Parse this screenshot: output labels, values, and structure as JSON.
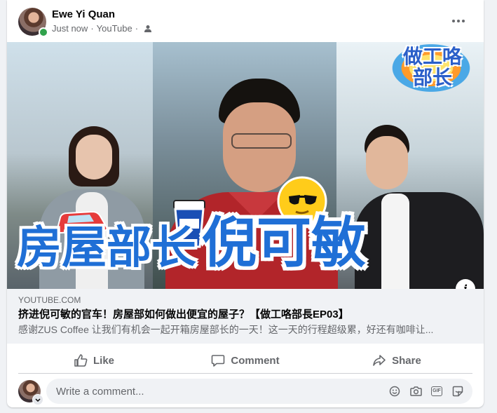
{
  "post": {
    "author": "Ewe Yi Quan",
    "time": "Just now",
    "separator": "·",
    "source": "YouTube",
    "audience_icon": "friends-icon"
  },
  "media": {
    "overlay_title_part1": "房屋部长",
    "overlay_title_part2": "倪可敏",
    "logo_text": "做工咯\n部长",
    "info_label": "i"
  },
  "link": {
    "domain": "YOUTUBE.COM",
    "title": "挤进倪可敏的官车！房屋部如何做出便宜的屋子？【做工咯部長EP03】",
    "description": "感谢ZUS Coffee 让我们有机会一起开箱房屋部长的一天！这一天的行程超级累，好还有咖啡让..."
  },
  "actions": {
    "like": "Like",
    "comment": "Comment",
    "share": "Share"
  },
  "comment_box": {
    "placeholder": "Write a comment..."
  },
  "colors": {
    "accent": "#1f6fd6",
    "online": "#31a24c",
    "secondary_text": "#65676b"
  }
}
